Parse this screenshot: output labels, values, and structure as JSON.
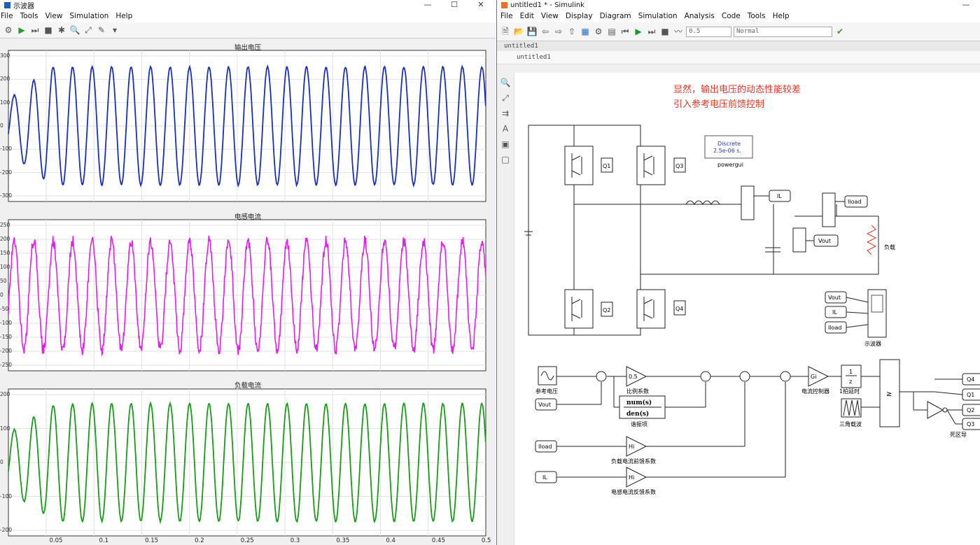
{
  "scope": {
    "title": "示波器",
    "menu": [
      "File",
      "Tools",
      "View",
      "Simulation",
      "Help"
    ],
    "plots": [
      {
        "title": "输出电压",
        "color": "#1a2fb5",
        "yticks": [
          "300",
          "200",
          "100",
          "0",
          "-100",
          "-200",
          "-300"
        ]
      },
      {
        "title": "电感电流",
        "color": "#e020e8",
        "yticks": [
          "250",
          "200",
          "150",
          "100",
          "50",
          "0",
          "-50",
          "-100",
          "-150",
          "-200",
          "-250"
        ]
      },
      {
        "title": "负载电流",
        "color": "#1a9a1a",
        "yticks": [
          "200",
          "100",
          "0",
          "-100",
          "-200"
        ]
      }
    ],
    "xticks": [
      "0.05",
      "0.1",
      "0.15",
      "0.2",
      "0.25",
      "0.3",
      "0.35",
      "0.4",
      "0.45",
      "0.5"
    ]
  },
  "sim": {
    "title": "untitled1 * - Simulink",
    "menu": [
      "File",
      "Edit",
      "View",
      "Display",
      "Diagram",
      "Simulation",
      "Analysis",
      "Code",
      "Tools",
      "Help"
    ],
    "stop_time": "0.5",
    "mode": "Normal",
    "tab": "untitled1",
    "breadcrumb": "untitled1",
    "annotation_line1": "显然，输出电压的动态性能较差",
    "annotation_line2": "引入参考电压前馈控制",
    "powergui": {
      "l1": "Discrete",
      "l2": "2.5e-06 s.",
      "name": "powergui"
    },
    "labels": {
      "q1": "Q1",
      "q2": "Q2",
      "q3": "Q3",
      "q4": "Q4",
      "il": "IL",
      "iload": "Iload",
      "vout": "Vout",
      "load": "负载",
      "scope": "示波器",
      "ref": "参考电压",
      "gain_val": "0.5",
      "gain_name": "比例系数",
      "num": "num(s)",
      "den": "den(s)",
      "tf_name": "谐振项",
      "gi": "Gi",
      "gi_name": "电流控制器",
      "delay_frac_n": "1",
      "delay_frac_d": "z",
      "delay_name": "1拍延时",
      "tri_name": "三角载波",
      "ge": "≥",
      "hi": "Hi",
      "ff_name": "负载电流前馈系数",
      "fb_name": "电感电流反馈系数",
      "dead_name": "死区导",
      "vout_in": "Vout",
      "iload_in": "Iload",
      "il_in": "IL"
    },
    "outputs": [
      "Q4",
      "Q1",
      "Q2",
      "Q3"
    ]
  }
}
